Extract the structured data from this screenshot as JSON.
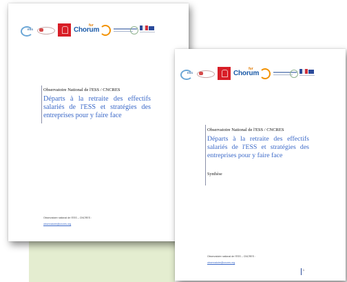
{
  "back_page": {
    "header_line": "Observatoire National de l'ESS / CNCRES",
    "title": "Départs à la retraite des effectifs salariés de l'ESS et stratégies des entreprises pour y faire face",
    "footer_label": "Observatoire national de l'ESS – CNCRES :",
    "footer_email": "observatoire@cncres.org"
  },
  "front_page": {
    "header_line": "Observatoire National de l'ESS / CNCRES",
    "title": "Départs à la retraite des effectifs salariés de l'ESS et stratégies des entreprises pour y faire face",
    "subtitle": "Synthèse",
    "footer_label": "Observatoire national de l'ESS – CNCRES :",
    "footer_email": "observatoire@cncres.org",
    "page_number": "1"
  },
  "logos": {
    "ess_logo_text": "ESS",
    "chorum_text": "Chorum",
    "chorum_sup": "fur"
  },
  "colors": {
    "title_blue": "#3a68c8",
    "chorum_blue": "#1a5aa8",
    "red_logo": "#d81e27",
    "green_background": "#e4edd0"
  }
}
